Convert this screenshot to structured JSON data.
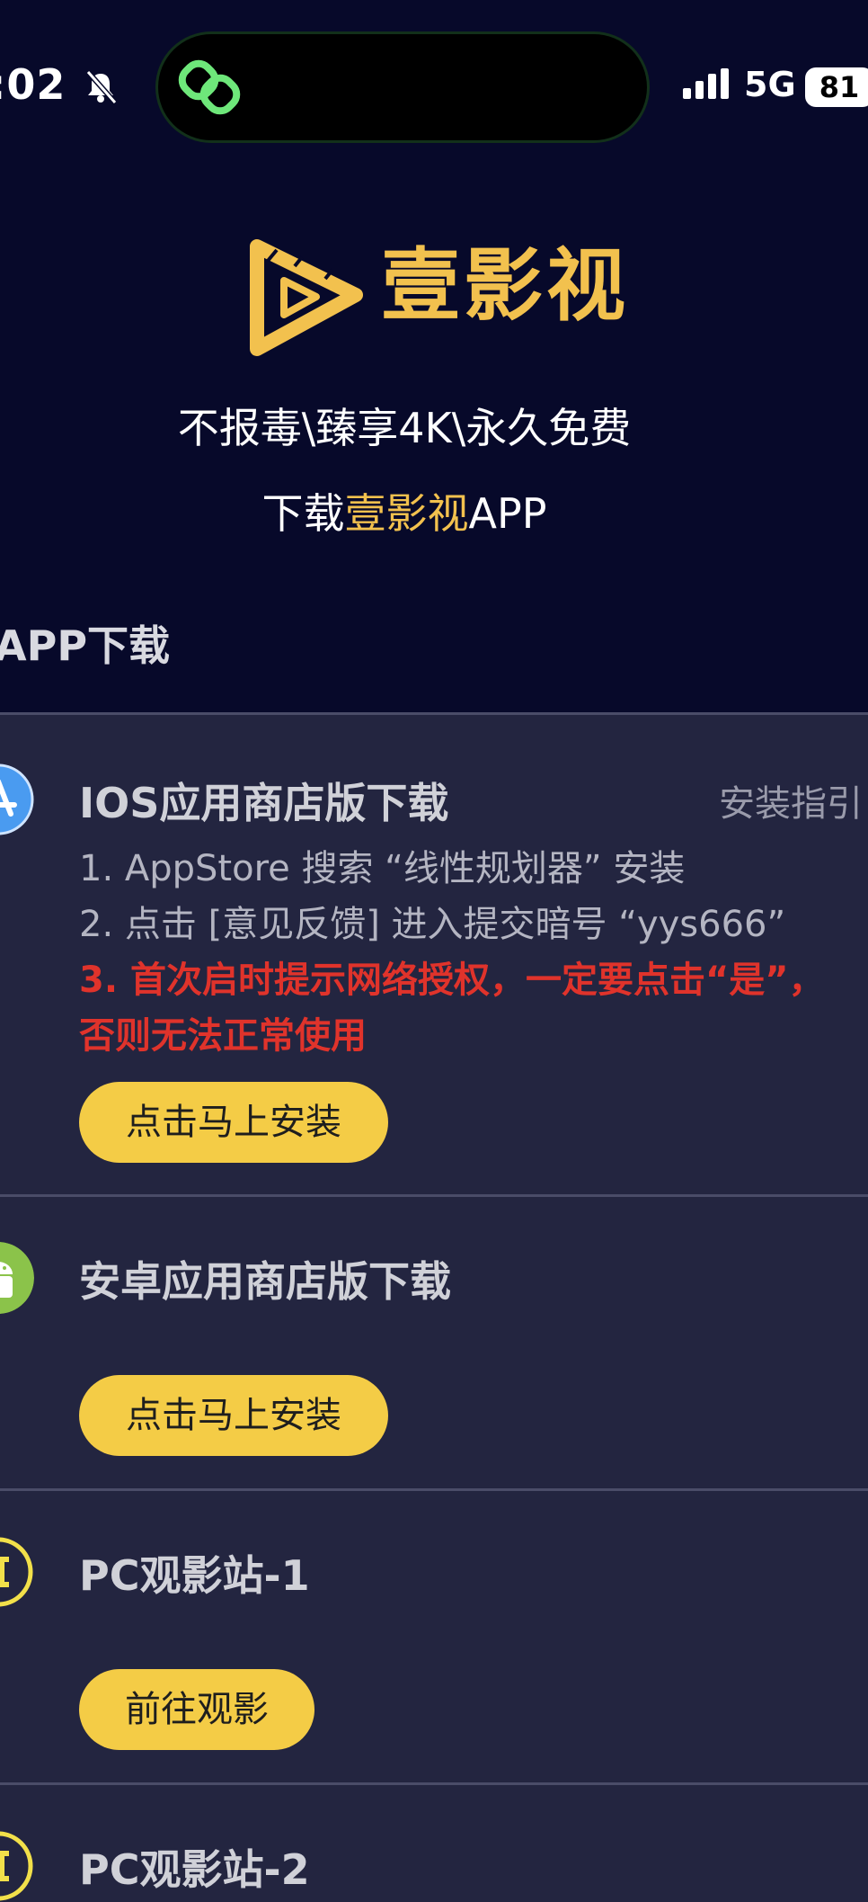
{
  "status_bar": {
    "time": ":02",
    "network": "5G",
    "battery": "81"
  },
  "brand": {
    "name": "壹影视",
    "slogan": "不报毒\\臻享4K\\永久免费",
    "download_prefix": "下载",
    "download_brand": "壹影视",
    "download_suffix": "APP"
  },
  "section_title": "APP下载",
  "cards": [
    {
      "title": "IOS应用商店版下载",
      "guide": "安装指引",
      "lines": [
        "1. AppStore 搜索 “线性规划器” 安装",
        "2. 点击 [意见反馈] 进入提交暗号 “yys666”"
      ],
      "warning": [
        "3. 首次启时提示网络授权，一定要点击“是”，",
        "否则无法正常使用"
      ],
      "button": "点击马上安装"
    },
    {
      "title": "安卓应用商店版下载",
      "button": "点击马上安装"
    },
    {
      "title": "PC观影站-1",
      "button": "前往观影"
    },
    {
      "title": "PC观影站-2"
    }
  ],
  "colors": {
    "accent": "#f2c14e",
    "button": "#f4cc46",
    "warning": "#e0332b",
    "header_bg": "#07092a",
    "card_bg": "#232540"
  }
}
